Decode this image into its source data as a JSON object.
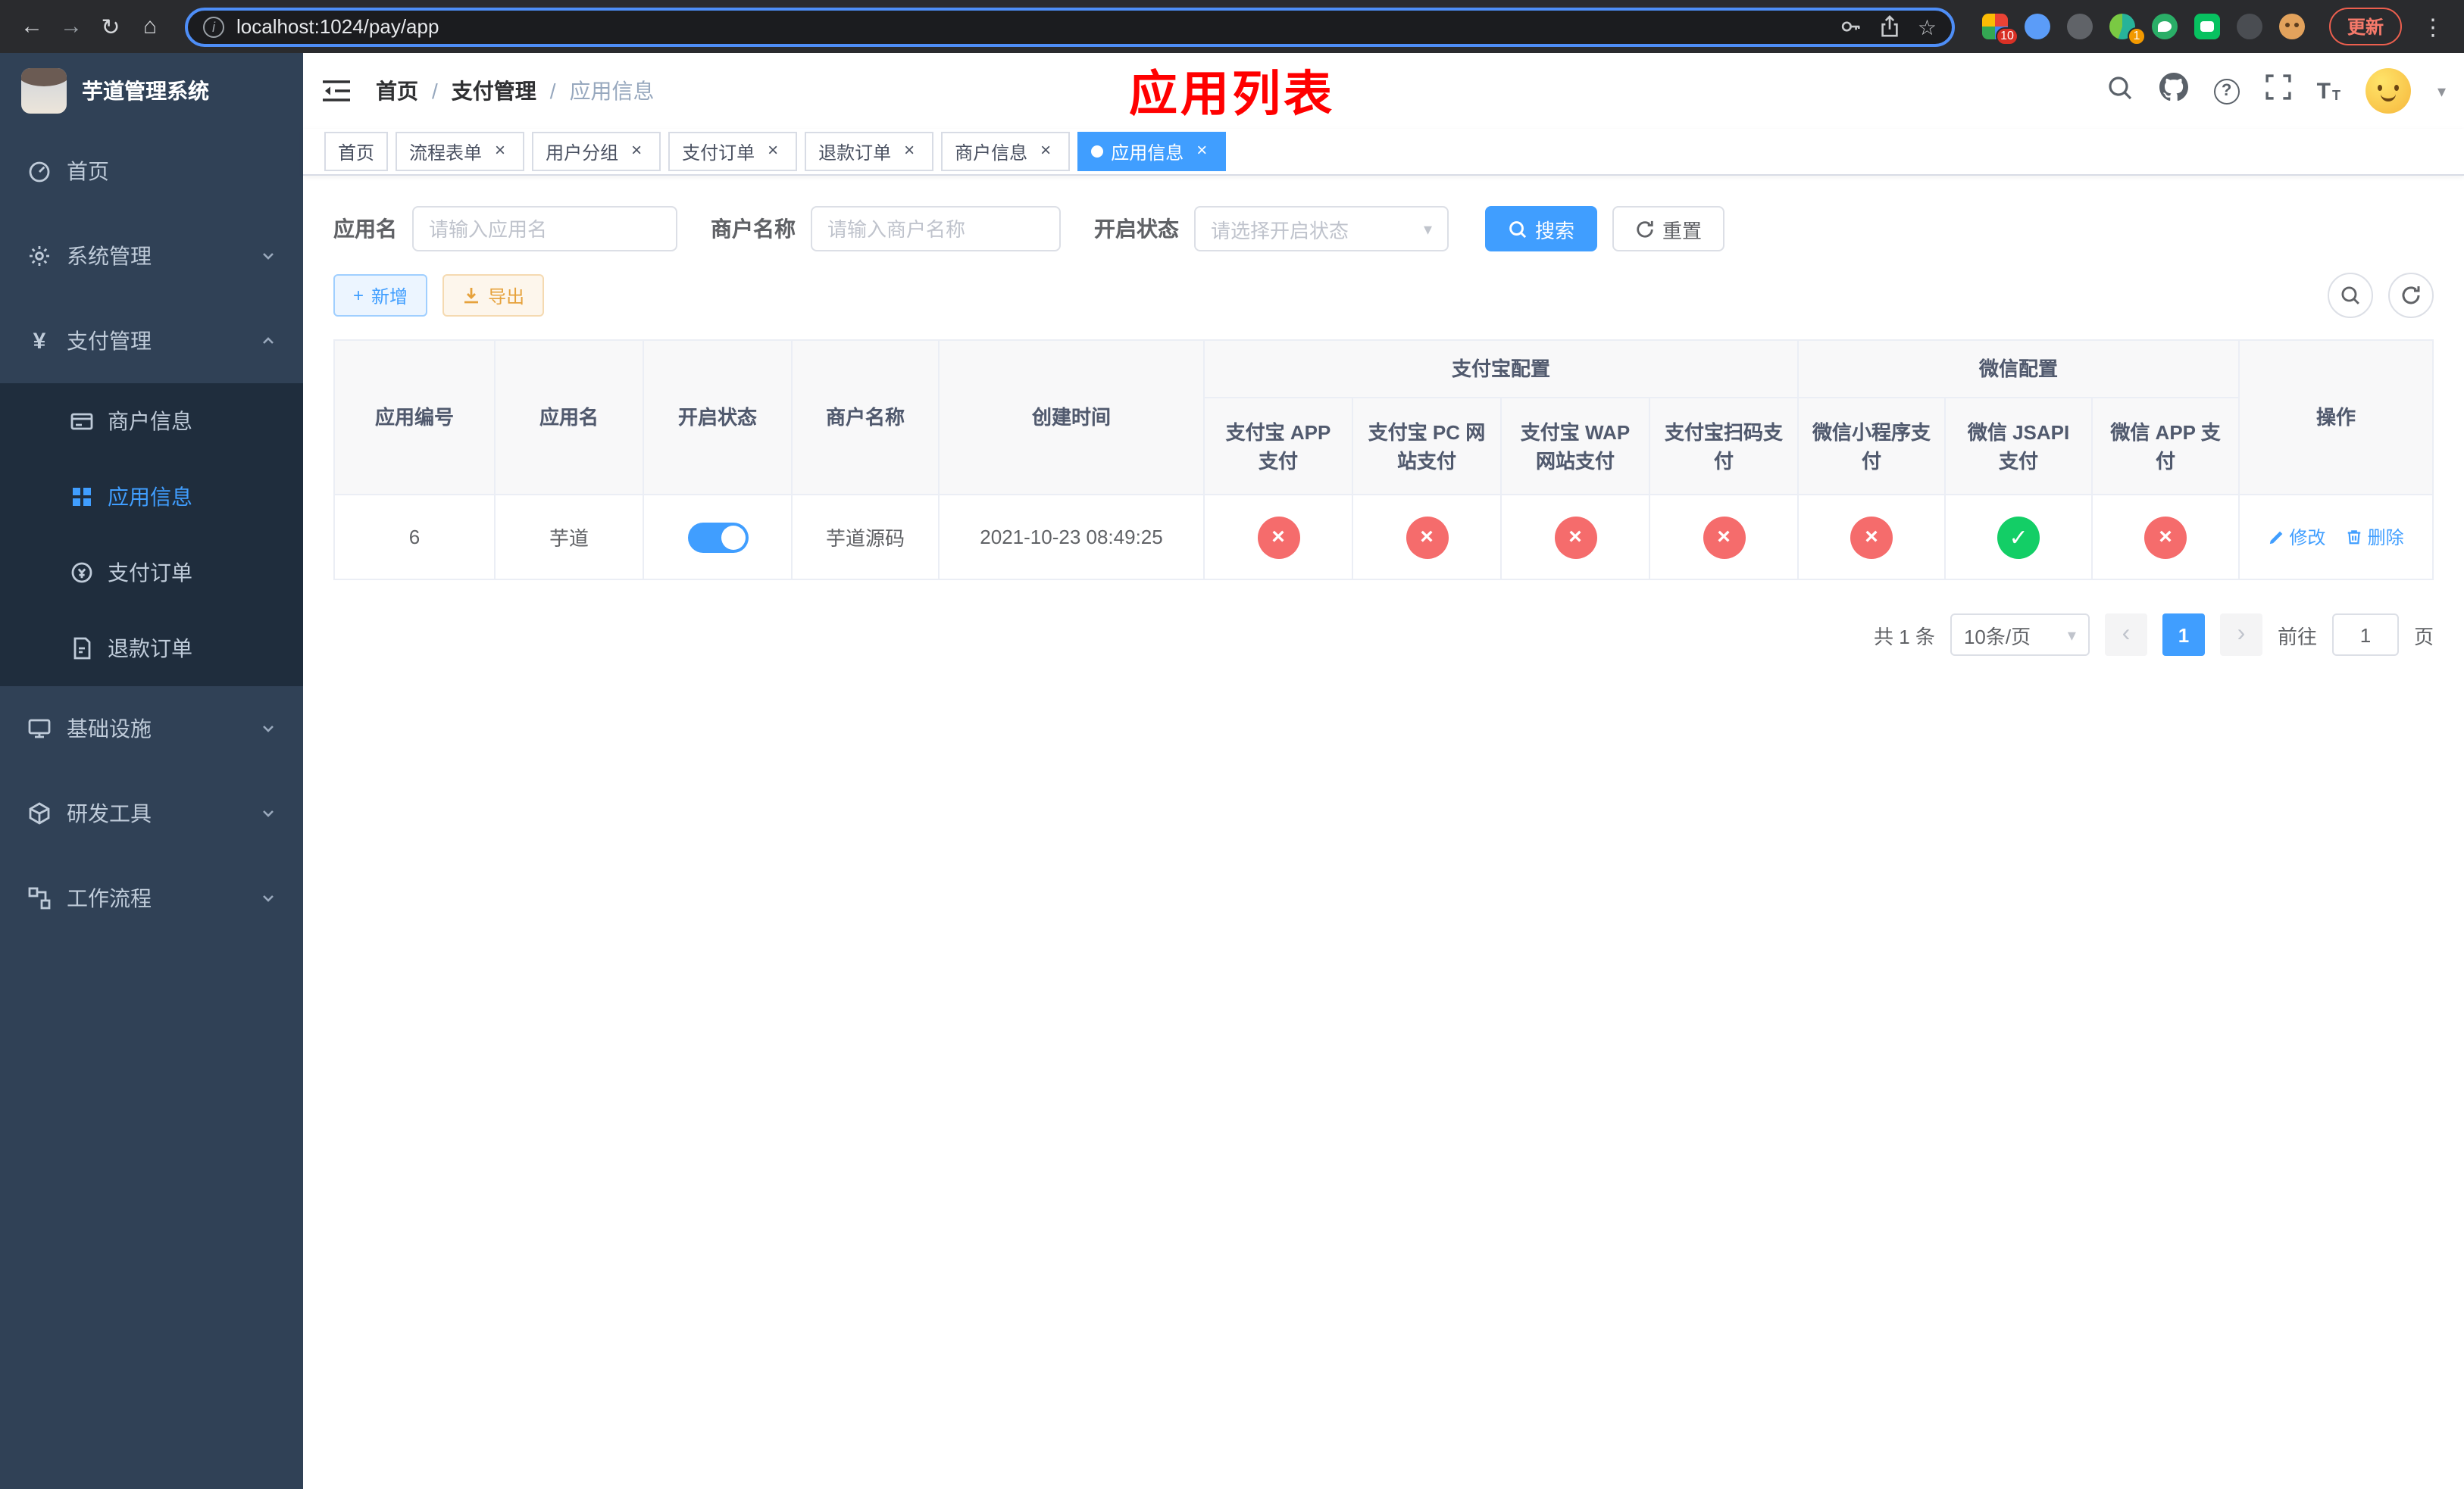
{
  "browser": {
    "url": "localhost:1024/pay/app",
    "update_label": "更新",
    "extension_badge_1": "10",
    "extension_badge_2": "1"
  },
  "icons": {
    "back": "←",
    "forward": "→",
    "reload": "↻",
    "home": "⌂",
    "info": "i",
    "star": "☆",
    "kebab": "⋮",
    "question": "?",
    "font_large": "T",
    "font_small": "T",
    "caret_down": "▾",
    "plus": "+",
    "check": "✓",
    "cross": "×",
    "prev": "‹",
    "next": "›",
    "yen": "¥",
    "breadcrumb_sep": "/"
  },
  "sidebar": {
    "title": "芋道管理系统",
    "items": {
      "home": "首页",
      "system": "系统管理",
      "payment": "支付管理",
      "infra": "基础设施",
      "devtools": "研发工具",
      "workflow": "工作流程"
    },
    "payment_children": {
      "merchant": "商户信息",
      "app": "应用信息",
      "pay_order": "支付订单",
      "refund_order": "退款订单"
    }
  },
  "header": {
    "breadcrumb": [
      "首页",
      "支付管理",
      "应用信息"
    ],
    "page_title": "应用列表",
    "title_color": "#ff0000"
  },
  "tabs": [
    {
      "label": "首页",
      "closable": false,
      "active": false
    },
    {
      "label": "流程表单",
      "closable": true,
      "active": false
    },
    {
      "label": "用户分组",
      "closable": true,
      "active": false
    },
    {
      "label": "支付订单",
      "closable": true,
      "active": false
    },
    {
      "label": "退款订单",
      "closable": true,
      "active": false
    },
    {
      "label": "商户信息",
      "closable": true,
      "active": false
    },
    {
      "label": "应用信息",
      "closable": true,
      "active": true
    }
  ],
  "filters": {
    "app_name_label": "应用名",
    "app_name_placeholder": "请输入应用名",
    "merchant_label": "商户名称",
    "merchant_placeholder": "请输入商户名称",
    "status_label": "开启状态",
    "status_placeholder": "请选择开启状态",
    "search_label": "搜索",
    "reset_label": "重置"
  },
  "toolbar": {
    "add_label": "新增",
    "export_label": "导出"
  },
  "table": {
    "columns": {
      "id": "应用编号",
      "name": "应用名",
      "status": "开启状态",
      "merchant": "商户名称",
      "created": "创建时间",
      "alipay_group": "支付宝配置",
      "alipay_app": "支付宝 APP 支付",
      "alipay_pc": "支付宝 PC 网站支付",
      "alipay_wap": "支付宝 WAP 网站支付",
      "alipay_qr": "支付宝扫码支付",
      "wechat_group": "微信配置",
      "wechat_lite": "微信小程序支付",
      "wechat_jsapi": "微信 JSAPI 支付",
      "wechat_app": "微信 APP 支付",
      "actions": "操作"
    },
    "row": {
      "id": "6",
      "name": "芋道",
      "enabled": true,
      "merchant": "芋道源码",
      "created": "2021-10-23 08:49:25",
      "statuses": {
        "alipay_app": false,
        "alipay_pc": false,
        "alipay_wap": false,
        "alipay_qr": false,
        "wechat_lite": false,
        "wechat_jsapi": true,
        "wechat_app": false
      },
      "edit_label": "修改",
      "delete_label": "删除"
    }
  },
  "pagination": {
    "total_text": "共 1 条",
    "page_size": "10条/页",
    "current_page": "1",
    "goto_label": "前往",
    "goto_value": "1",
    "page_unit": "页"
  },
  "colors": {
    "accent": "#409eff",
    "success": "#13ce66",
    "danger": "#f56c6c",
    "sidebar_bg": "#304156",
    "submenu_bg": "#1f2d3d"
  }
}
